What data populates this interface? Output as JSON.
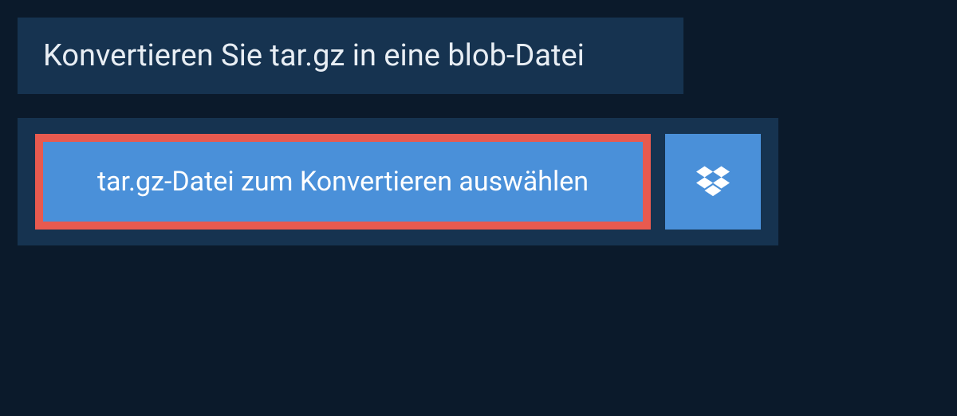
{
  "header": {
    "title": "Konvertieren Sie tar.gz in eine blob-Datei"
  },
  "upload": {
    "select_file_label": "tar.gz-Datei zum Konvertieren auswählen"
  },
  "colors": {
    "background": "#0b1a2b",
    "panel": "#163350",
    "button": "#4a90d9",
    "highlight_border": "#e85a4f",
    "text_light": "#e8eef4"
  }
}
